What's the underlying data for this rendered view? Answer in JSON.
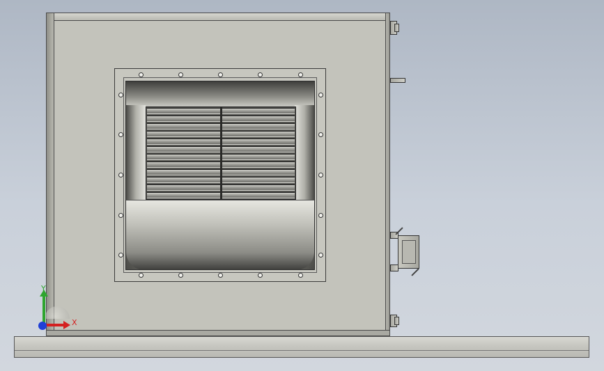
{
  "viewport": {
    "background_top": "#aeb7c4",
    "background_bottom": "#d2d7de"
  },
  "model": {
    "flange_bolt_count": 20,
    "impeller_blade_count": 12
  },
  "triad": {
    "x_label": "X",
    "y_label": "Y",
    "z_label": "Z",
    "x_color": "#d42020",
    "y_color": "#2fa52f",
    "z_color": "#1f3fd6"
  }
}
